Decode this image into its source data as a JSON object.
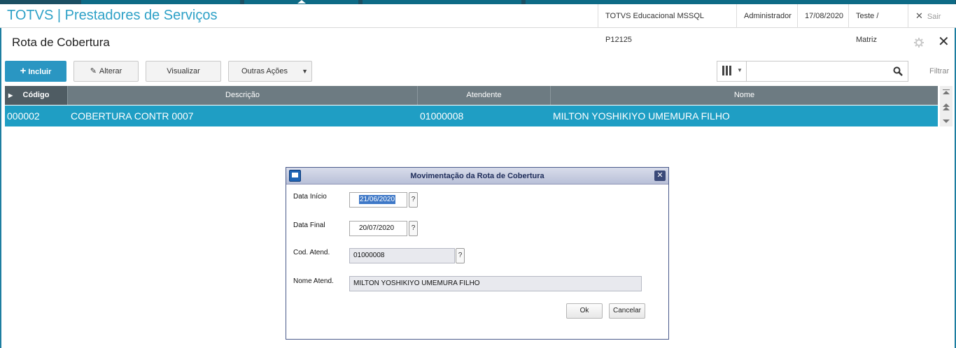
{
  "app": {
    "title": "TOTVS | Prestadores de Serviços",
    "environment": "TOTVS Educacional MSSQL P12125",
    "user": "Administrador",
    "date": "17/08/2020",
    "branch": "Teste / Matriz",
    "exit_label": "Sair"
  },
  "page": {
    "title": "Rota de Cobertura"
  },
  "toolbar": {
    "include_label": "Incluir",
    "alter_label": "Alterar",
    "view_label": "Visualizar",
    "other_actions_label": "Outras Ações",
    "filter_label": "Filtrar",
    "search_placeholder": ""
  },
  "grid": {
    "columns": [
      "Código",
      "Descrição",
      "Atendente",
      "Nome"
    ],
    "rows": [
      {
        "codigo": "000002",
        "descricao": "COBERTURA CONTR 0007",
        "atendente": "01000008",
        "nome": "MILTON YOSHIKIYO UMEMURA FILHO"
      }
    ]
  },
  "dialog": {
    "title": "Movimentação da Rota de Cobertura",
    "fields": {
      "data_inicio_label": "Data Início",
      "data_inicio_value": "21/06/2020",
      "data_final_label": "Data Final",
      "data_final_value": "20/07/2020",
      "cod_atend_label": "Cod. Atend.",
      "cod_atend_value": "01000008",
      "nome_atend_label": "Nome Atend.",
      "nome_atend_value": "MILTON YOSHIKIYO UMEMURA FILHO",
      "lookup_label": "?"
    },
    "ok_label": "Ok",
    "cancel_label": "Cancelar"
  },
  "colors": {
    "brand": "#2ea1c7",
    "primary_button": "#2a96c2",
    "selected_row": "#1f9ec4",
    "grid_header": "#6d7b82"
  }
}
